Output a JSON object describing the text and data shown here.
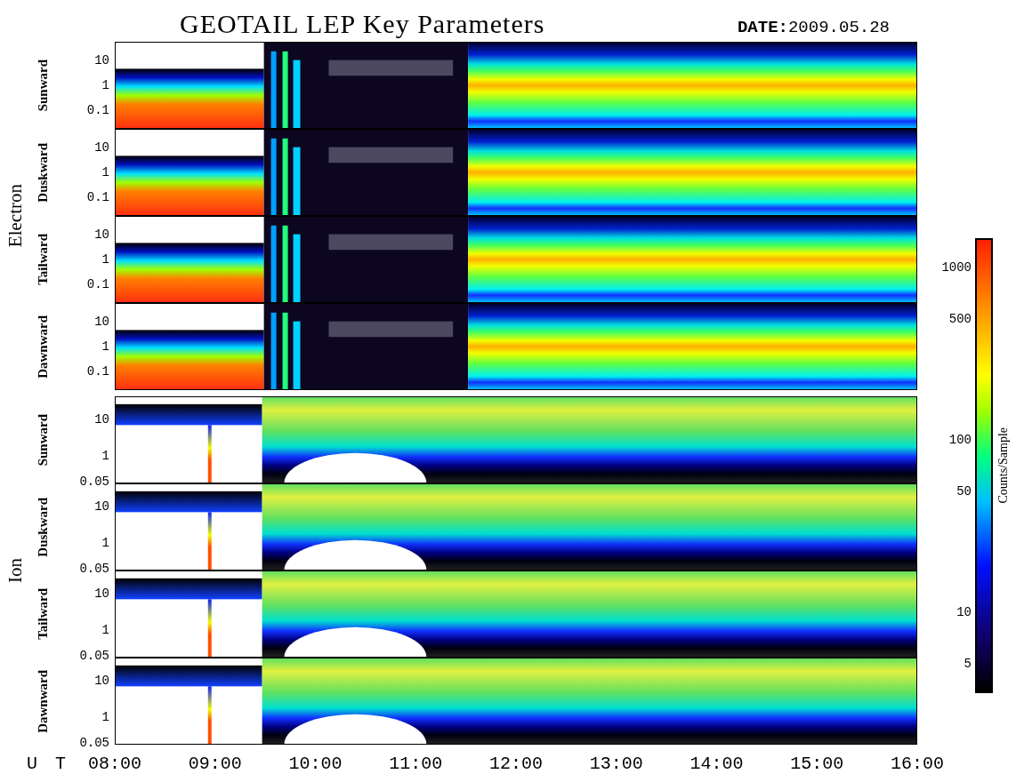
{
  "title": "GEOTAIL LEP Key Parameters",
  "date": "**DATE:**2009.05.28",
  "groups": [
    {
      "label": "Electron",
      "kind": "electron",
      "panels": [
        {
          "label": "Sunward",
          "yticks": [
            "10",
            "1",
            "0.1"
          ]
        },
        {
          "label": "Duskward",
          "yticks": [
            "10",
            "1",
            "0.1"
          ]
        },
        {
          "label": "Tailward",
          "yticks": [
            "10",
            "1",
            "0.1"
          ]
        },
        {
          "label": "Dawnward",
          "yticks": [
            "10",
            "1",
            "0.1"
          ]
        }
      ]
    },
    {
      "label": "Ion",
      "kind": "ion",
      "panels": [
        {
          "label": "Sunward",
          "yticks": [
            "10",
            "1",
            "0.05"
          ]
        },
        {
          "label": "Duskward",
          "yticks": [
            "10",
            "1",
            "0.05"
          ]
        },
        {
          "label": "Tailward",
          "yticks": [
            "10",
            "1",
            "0.05"
          ]
        },
        {
          "label": "Dawnward",
          "yticks": [
            "10",
            "1",
            "0.05"
          ]
        }
      ]
    }
  ],
  "xaxis": {
    "label": "U T",
    "ticks": [
      "08:00",
      "09:00",
      "10:00",
      "11:00",
      "12:00",
      "13:00",
      "14:00",
      "15:00",
      "16:00"
    ]
  },
  "colorbar": {
    "label": "Counts/Sample",
    "ticks": [
      "1000",
      "500",
      "100",
      "50",
      "10",
      "5"
    ]
  }
}
